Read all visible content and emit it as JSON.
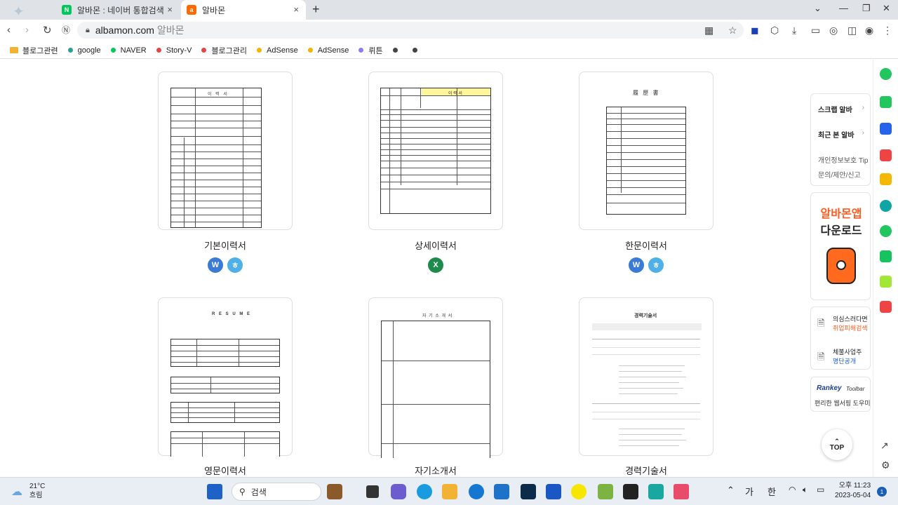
{
  "browser": {
    "tabs": [
      {
        "label": "알바몬 : 네이버 통합검색",
        "icon": "naver-icon"
      },
      {
        "label": "알바몬",
        "icon": "albamon-icon"
      }
    ],
    "address": {
      "host": "albamon.com",
      "title": "알바몬"
    },
    "bookmarks": [
      {
        "label": "블로그관련",
        "type": "folder",
        "color": "#f2b233"
      },
      {
        "label": "google",
        "color": "#2e9e8f"
      },
      {
        "label": "NAVER",
        "color": "#03c75a"
      },
      {
        "label": "Story-V",
        "color": "#e64545"
      },
      {
        "label": "블로그관리",
        "color": "#e64545"
      },
      {
        "label": "AdSense",
        "color": "#f4b400"
      },
      {
        "label": "AdSense",
        "color": "#f4b400"
      },
      {
        "label": "뤼튼",
        "color": "#8e7cf0"
      },
      {
        "label": "",
        "color": "#444"
      },
      {
        "label": "",
        "color": "#444"
      }
    ]
  },
  "cards": [
    {
      "title": "기본이력서",
      "badges": [
        "W",
        "ㅎ"
      ]
    },
    {
      "title": "상세이력서",
      "badges": [
        "X"
      ]
    },
    {
      "title": "한문이력서",
      "badges": [
        "W",
        "ㅎ"
      ]
    },
    {
      "title": "영문이력서",
      "badges": []
    },
    {
      "title": "자기소개서",
      "badges": []
    },
    {
      "title": "경력기술서",
      "badges": []
    }
  ],
  "docs": {
    "basic_title": "이 력 서",
    "detail_title": "이 력 서",
    "hanja_title": "履 歷 書",
    "english_title": "R E S U M E",
    "intro_title": "자 기 소 개 서",
    "career_title": "경력기술서"
  },
  "sidebar": {
    "scrap": "스크랩 알바",
    "recent": "최근 본 알바",
    "privacy": "개인정보보호 Tip",
    "inquiry": "문의/제안/신고",
    "app_line1": "알바몬앱",
    "app_line2": "다운로드",
    "fraud_line1": "의심스러다면",
    "fraud_line2": "취업피해검색",
    "arrears_line1": "체불사업주",
    "arrears_line2": "명단공개",
    "rankey": "Rankey",
    "rankey_sub": "Toolbar",
    "rankey_desc": "편리한 웹서핑 도우미",
    "top": "TOP"
  },
  "taskbar": {
    "temp": "21°C",
    "weather": "흐림",
    "search": "검색",
    "ime1": "가",
    "ime2": "한",
    "time": "오후 11:23",
    "date": "2023-05-04",
    "notifications": "1"
  }
}
